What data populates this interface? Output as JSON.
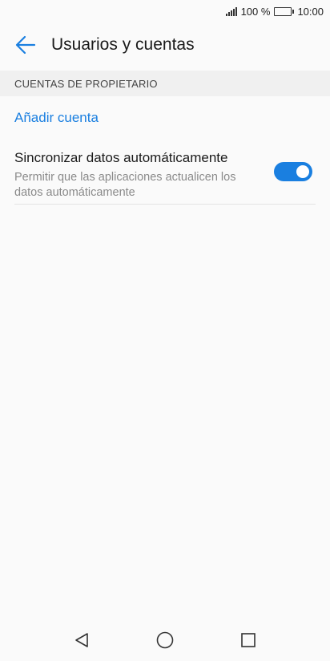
{
  "status_bar": {
    "battery_percent": "100 %",
    "time": "10:00",
    "icons": [
      "signal-icon",
      "battery-icon"
    ]
  },
  "toolbar": {
    "title": "Usuarios y cuentas",
    "back_icon": "arrow-left-icon"
  },
  "section": {
    "header": "CUENTAS DE PROPIETARIO"
  },
  "add_account": {
    "label": "Añadir cuenta"
  },
  "sync": {
    "title": "Sincronizar datos automáticamente",
    "subtitle": "Permitir que las aplicaciones actualicen los datos automáticamente",
    "enabled": true
  },
  "nav_bar": {
    "icons": [
      "back-triangle-icon",
      "home-circle-icon",
      "recents-square-icon"
    ]
  },
  "colors": {
    "accent": "#1a7fe0",
    "background": "#fafafa",
    "section_header_bg": "#f0f0f0"
  }
}
